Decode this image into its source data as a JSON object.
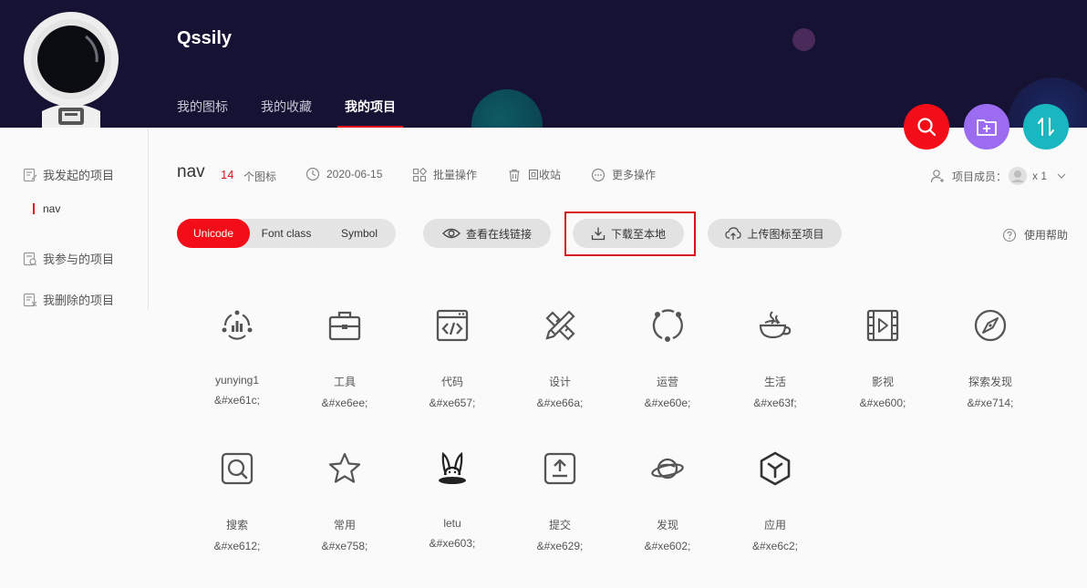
{
  "header": {
    "username": "Qssily",
    "tabs": [
      "我的图标",
      "我的收藏",
      "我的项目"
    ],
    "active_tab": "我的项目"
  },
  "sidebar": {
    "items": [
      {
        "label": "我发起的项目",
        "icon": "project-owner-icon"
      },
      {
        "label": "我参与的项目",
        "icon": "project-member-icon"
      },
      {
        "label": "我删除的项目",
        "icon": "project-deleted-icon"
      }
    ],
    "sub_items": [
      {
        "label": "nav",
        "active": true
      }
    ]
  },
  "project": {
    "name": "nav",
    "icon_count": "14",
    "icon_count_label": "个图标",
    "date": "2020-06-15",
    "batch_label": "批量操作",
    "recycle_label": "回收站",
    "more_label": "更多操作",
    "members_label": "项目成员：",
    "members_count": "x 1"
  },
  "toolbar": {
    "segments": [
      "Unicode",
      "Font class",
      "Symbol"
    ],
    "active_segment": "Unicode",
    "view_link_label": "查看在线链接",
    "download_label": "下载至本地",
    "upload_label": "上传图标至项目",
    "help_label": "使用帮助"
  },
  "icons": [
    {
      "name": "yunying1",
      "code": "&#xe61c;",
      "glyph": "operations-chart-icon"
    },
    {
      "name": "工具",
      "code": "&#xe6ee;",
      "glyph": "toolbox-icon"
    },
    {
      "name": "代码",
      "code": "&#xe657;",
      "glyph": "code-window-icon"
    },
    {
      "name": "设计",
      "code": "&#xe66a;",
      "glyph": "pencil-ruler-icon"
    },
    {
      "name": "运营",
      "code": "&#xe60e;",
      "glyph": "orbit-nodes-icon"
    },
    {
      "name": "生活",
      "code": "&#xe63f;",
      "glyph": "coffee-cup-icon"
    },
    {
      "name": "影视",
      "code": "&#xe600;",
      "glyph": "film-play-icon"
    },
    {
      "name": "探索发现",
      "code": "&#xe714;",
      "glyph": "compass-icon"
    },
    {
      "name": "搜索",
      "code": "&#xe612;",
      "glyph": "search-square-icon"
    },
    {
      "name": "常用",
      "code": "&#xe758;",
      "glyph": "star-icon"
    },
    {
      "name": "letu",
      "code": "&#xe603;",
      "glyph": "rabbit-hat-icon"
    },
    {
      "name": "提交",
      "code": "&#xe629;",
      "glyph": "upload-box-icon"
    },
    {
      "name": "发现",
      "code": "&#xe602;",
      "glyph": "planet-icon"
    },
    {
      "name": "应用",
      "code": "&#xe6c2;",
      "glyph": "hexagon-cube-icon"
    }
  ],
  "colors": {
    "header_bg": "#151233",
    "accent_red": "#f20d18",
    "fab_purple": "#9c6cf0",
    "fab_teal": "#1ab7c1"
  }
}
